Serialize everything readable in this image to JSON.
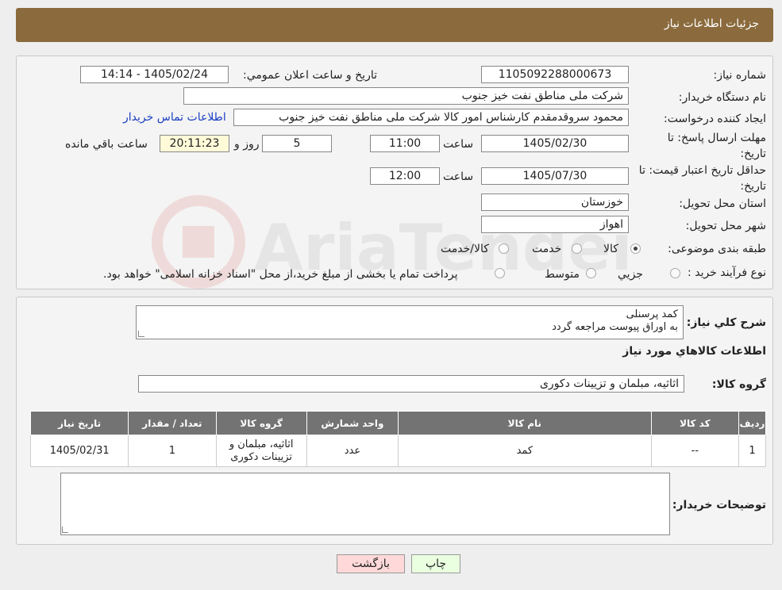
{
  "header": {
    "title": "جزئیات اطلاعات نیاز"
  },
  "form": {
    "need_number": {
      "label": "شماره نیاز:",
      "value": "1105092288000673"
    },
    "announce_datetime": {
      "label": "تاریخ و ساعت اعلان عمومي:",
      "value": "1405/02/24 - 14:14"
    },
    "buyer_org": {
      "label": "نام دستگاه خریدار:",
      "value": "شرکت ملی مناطق نفت خیز جنوب"
    },
    "requester": {
      "label": "ایجاد کننده درخواست:",
      "value": "محمود سروقدمقدم کارشناس امور کالا شرکت ملی مناطق نفت خیز جنوب"
    },
    "contact_link": "اطلاعات تماس خریدار",
    "reply_deadline": {
      "label": "مهلت ارسال پاسخ: تا تاریخ:",
      "date": "1405/02/30",
      "time_label": "ساعت",
      "time": "11:00",
      "days": "5",
      "days_label": "روز و",
      "remaining": "20:11:23",
      "remaining_label": "ساعت باقي مانده"
    },
    "price_validity": {
      "label": "حداقل تاریخ اعتبار قیمت: تا تاریخ:",
      "date": "1405/07/30",
      "time_label": "ساعت",
      "time": "12:00"
    },
    "province": {
      "label": "استان محل تحویل:",
      "value": "خوزستان"
    },
    "city": {
      "label": "شهر محل تحویل:",
      "value": "اهواز"
    },
    "category": {
      "label": "طبقه بندی موضوعی:",
      "options": [
        "کالا",
        "خدمت",
        "کالا/خدمت"
      ],
      "selected": "کالا"
    },
    "process": {
      "label": "نوع فرآیند خرید :",
      "options": [
        "جزيي",
        "متوسط"
      ],
      "note": "پرداخت تمام یا بخشی از مبلغ خرید،از محل \"اسناد خزانه اسلامی\" خواهد بود."
    }
  },
  "summary": {
    "label": "شرح کلي نياز:",
    "lines": [
      "کمد پرسنلی",
      "به اوراق پیوست مراجعه گردد"
    ]
  },
  "goods_section": {
    "title": "اطلاعات کالاهاي مورد نياز"
  },
  "goods_group": {
    "label": "گروه کالا:",
    "value": "اثاثیه، مبلمان و تزیینات دکوری"
  },
  "table": {
    "headers": [
      "رديف",
      "کد کالا",
      "نام کالا",
      "واحد شمارش",
      "گروه کالا",
      "تعداد / مقدار",
      "تاریخ نیاز"
    ],
    "rows": [
      [
        "1",
        "--",
        "کمد",
        "عدد",
        "اثاثیه، مبلمان و تزیینات دکوری",
        "1",
        "1405/02/31"
      ]
    ]
  },
  "buyer_notes": {
    "label": "توضیحات خریدار:",
    "value": ""
  },
  "buttons": {
    "print": "چاپ",
    "back": "بازگشت"
  },
  "colors": {
    "header_bg": "#8b6b3d",
    "table_header_bg": "#737373",
    "link": "#1a3fc2",
    "back_btn": "#ffd9d9",
    "print_btn": "#eaffe0"
  }
}
